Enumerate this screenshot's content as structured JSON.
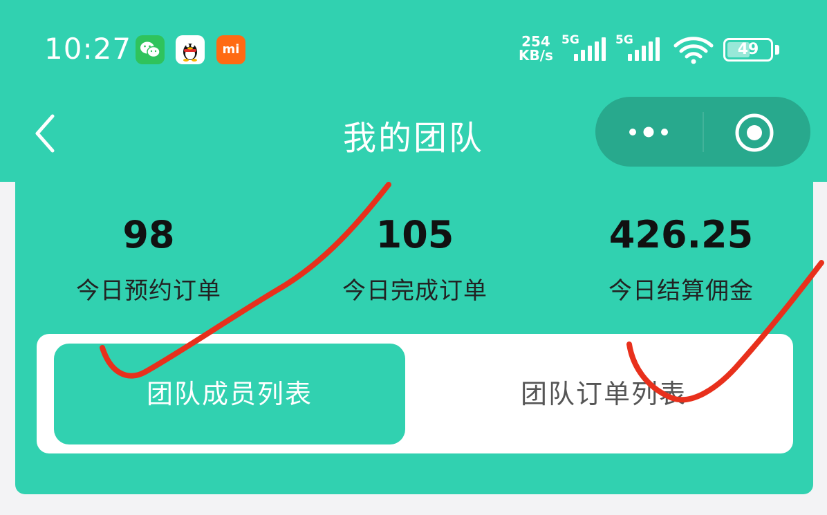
{
  "status_bar": {
    "time": "10:27",
    "net_speed_value": "254",
    "net_speed_unit": "KB/s",
    "sim1_label": "5G",
    "sim2_label": "5G",
    "battery": "49",
    "apps": [
      "wechat-icon",
      "qq-icon",
      "mi-icon"
    ]
  },
  "nav": {
    "title": "我的团队",
    "back_icon": "chevron-left-icon",
    "more_icon": "more-dots-icon",
    "close_icon": "target-close-icon"
  },
  "stats": [
    {
      "value": "98",
      "label": "今日预约订单"
    },
    {
      "value": "105",
      "label": "今日完成订单"
    },
    {
      "value": "426.25",
      "label": "今日结算佣金"
    }
  ],
  "tabs": [
    {
      "label": "团队成员列表",
      "active": true
    },
    {
      "label": "团队订单列表",
      "active": false
    }
  ],
  "colors": {
    "brand": "#31d1b0",
    "capsule": "#28a98d",
    "annotation": "#e8301c"
  }
}
